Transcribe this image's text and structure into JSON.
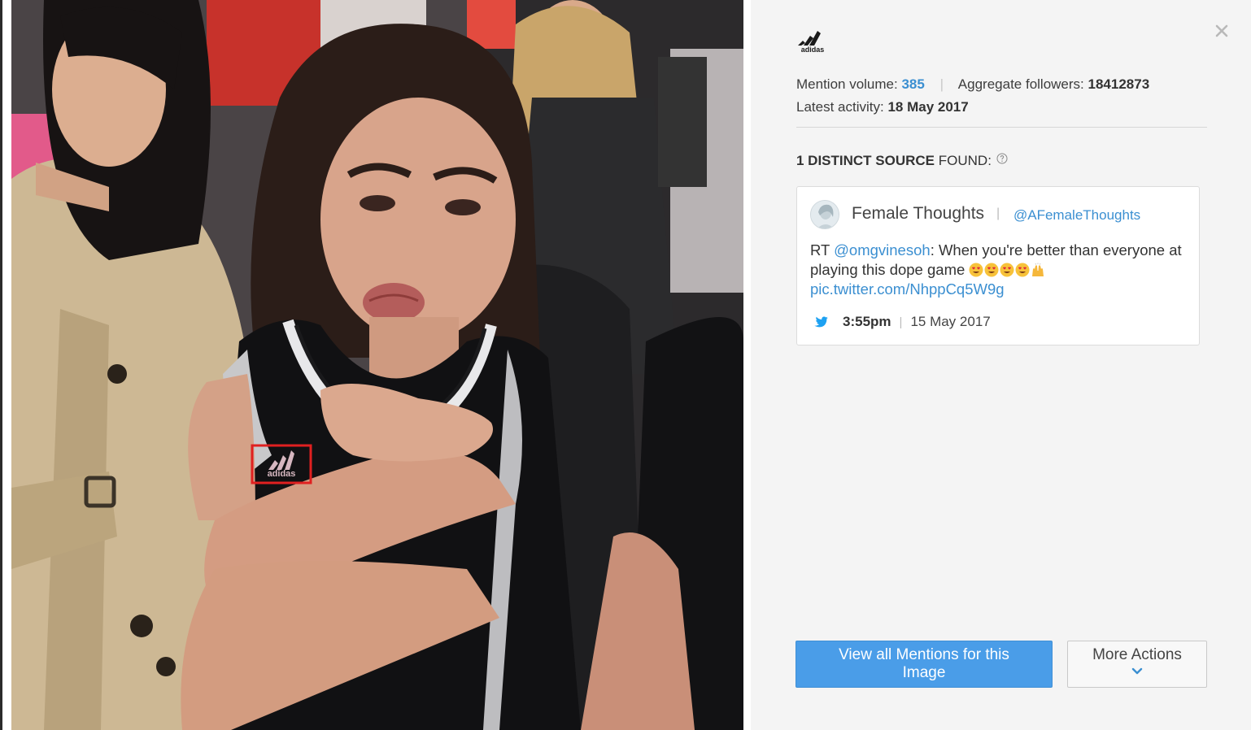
{
  "brand": {
    "name": "adidas",
    "logo_icon": "adidas-logo-icon"
  },
  "stats": {
    "mention_volume_label": "Mention volume:",
    "mention_volume_value": "385",
    "followers_label": "Aggregate followers:",
    "followers_value": "18412873",
    "latest_activity_label": "Latest activity:",
    "latest_activity_value": "18 May 2017"
  },
  "sources": {
    "count_bold": "1 DISTINCT SOURCE",
    "suffix": " FOUND:",
    "help_icon": "question-circle-icon"
  },
  "tweet": {
    "author_name": "Female Thoughts",
    "author_sep": "|",
    "handle": "@AFemaleThoughts",
    "prefix": "RT ",
    "mention": "@omgvinesoh",
    "body": ": When you're better than everyone at playing this dope game ",
    "emojis": [
      "heart-eyes",
      "heart-eyes",
      "heart-eyes",
      "heart-eyes",
      "raised-hands"
    ],
    "link": "pic.twitter.com/NhppCq5W9g",
    "time": "3:55pm",
    "date": "15 May 2017",
    "source_icon": "twitter-icon"
  },
  "actions": {
    "primary_label": "View all Mentions for this Image",
    "secondary_label": "More Actions",
    "secondary_icon": "chevron-down-icon"
  },
  "colors": {
    "link": "#3b8fd1",
    "primary_button": "#4a9de8",
    "panel_bg": "#f4f4f4",
    "detection_box": "#e02020"
  },
  "photo": {
    "description_icon": "photo",
    "detected_logo_label": "adidas"
  }
}
